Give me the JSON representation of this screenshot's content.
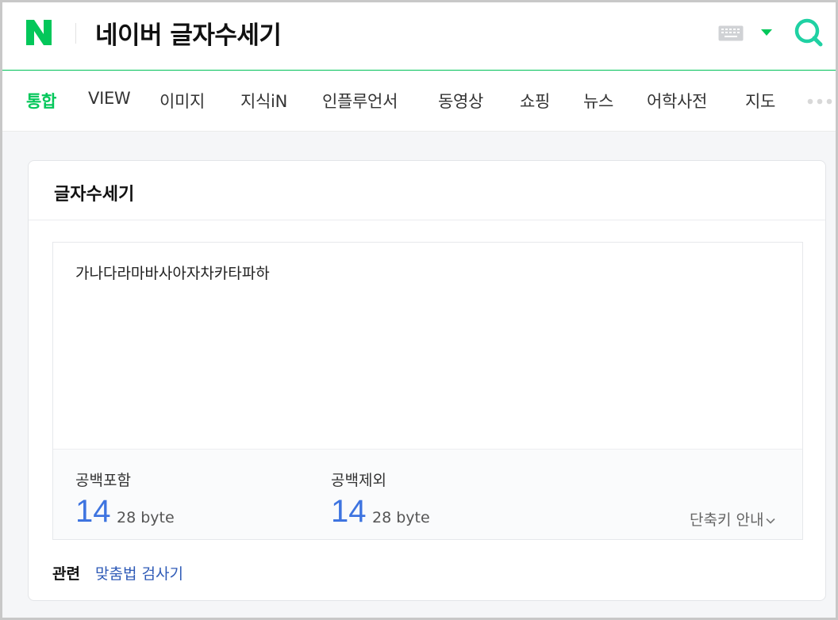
{
  "header": {
    "title": "네이버 글자수세기",
    "logo_letter": "N",
    "brand_color": "#03c75a"
  },
  "icons": {
    "logo": "naver-logo-icon",
    "keyboard": "keyboard-icon",
    "dropdown": "caret-down-icon",
    "search": "search-icon",
    "more": "more-dots-icon",
    "chevron": "chevron-down-icon"
  },
  "tabs": [
    {
      "label": "통합",
      "active": true
    },
    {
      "label": "VIEW",
      "active": false
    },
    {
      "label": "이미지",
      "active": false
    },
    {
      "label": "지식iN",
      "active": false
    },
    {
      "label": "인플루언서",
      "active": false
    },
    {
      "label": "동영상",
      "active": false
    },
    {
      "label": "쇼핑",
      "active": false
    },
    {
      "label": "뉴스",
      "active": false
    },
    {
      "label": "어학사전",
      "active": false
    },
    {
      "label": "지도",
      "active": false
    }
  ],
  "card": {
    "title": "글자수세기",
    "input_text": "가나다라마바사아자차카타파하",
    "with_spaces": {
      "label": "공백포함",
      "count": "14",
      "bytes": "28 byte"
    },
    "without_spaces": {
      "label": "공백제외",
      "count": "14",
      "bytes": "28 byte"
    },
    "shortcut_label": "단축키 안내"
  },
  "related": {
    "label": "관련",
    "link": "맞춤법 검사기"
  },
  "colors": {
    "accent_green": "#03c75a",
    "count_blue": "#3e74e0",
    "link_blue": "#2f5bb7"
  }
}
